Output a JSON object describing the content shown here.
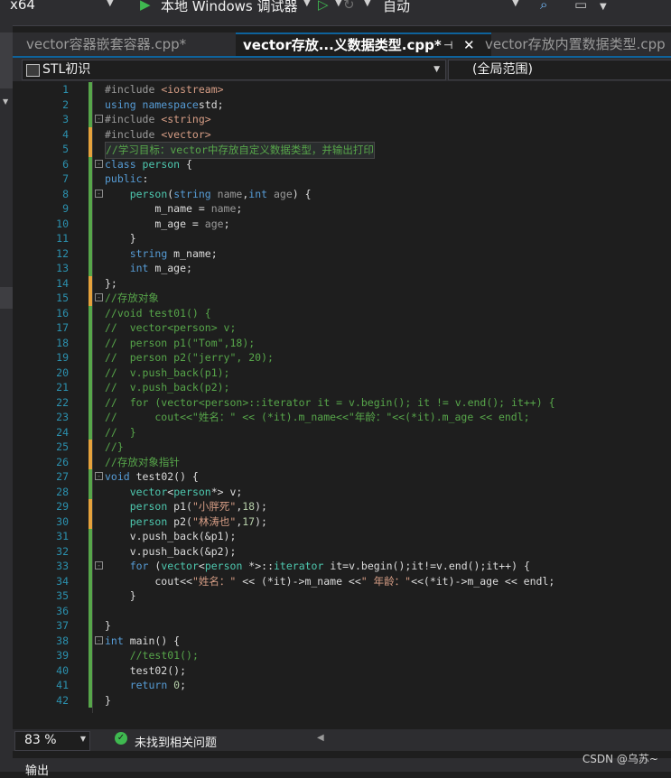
{
  "toolbar": {
    "platform": "x64",
    "run_label": "本地 Windows 调试器",
    "config": "自动"
  },
  "tabs": [
    {
      "label": "vector容器嵌套容器.cpp*",
      "active": false
    },
    {
      "label": "vector存放...义数据类型.cpp*",
      "active": true
    },
    {
      "label": "vector存放内置数据类型.cpp",
      "active": false
    }
  ],
  "navbar": {
    "project": "STL初识",
    "scope": "(全局范围)"
  },
  "code_lines": [
    {
      "n": "1",
      "chg": "g",
      "fold": "",
      "tokens": [
        [
          "pp",
          "#include "
        ],
        [
          "st",
          "<iostream>"
        ]
      ]
    },
    {
      "n": "2",
      "chg": "g",
      "fold": "",
      "tokens": [
        [
          "kw",
          "using namespace"
        ],
        [
          "",
          "std;"
        ]
      ]
    },
    {
      "n": "3",
      "chg": "g",
      "fold": "-",
      "tokens": [
        [
          "pp",
          "#include "
        ],
        [
          "st",
          "<string>"
        ]
      ]
    },
    {
      "n": "4",
      "chg": "y",
      "fold": "",
      "tokens": [
        [
          "pp",
          "#include "
        ],
        [
          "st",
          "<vector>"
        ]
      ]
    },
    {
      "n": "5",
      "chg": "y",
      "fold": "",
      "hl": true,
      "tokens": [
        [
          "cm",
          "//学习目标：vector中存放自定义数据类型，并输出打印"
        ]
      ]
    },
    {
      "n": "6",
      "chg": "g",
      "fold": "-",
      "tokens": [
        [
          "kw",
          "class "
        ],
        [
          "ty",
          "person "
        ],
        [
          "",
          "{"
        ]
      ]
    },
    {
      "n": "7",
      "chg": "g",
      "fold": "",
      "tokens": [
        [
          "kw",
          "public"
        ],
        [
          "",
          ":"
        ]
      ]
    },
    {
      "n": "8",
      "chg": "g",
      "fold": "-",
      "tokens": [
        [
          "",
          "    "
        ],
        [
          "ty",
          "person"
        ],
        [
          "",
          "("
        ],
        [
          "kw",
          "string "
        ],
        [
          "pa",
          "name"
        ],
        [
          "",
          ","
        ],
        [
          "kw",
          "int "
        ],
        [
          "pa",
          "age"
        ],
        [
          "",
          ") {"
        ]
      ]
    },
    {
      "n": "9",
      "chg": "g",
      "fold": "",
      "tokens": [
        [
          "",
          "        m_name = "
        ],
        [
          "pa",
          "name"
        ],
        [
          "",
          ";"
        ]
      ]
    },
    {
      "n": "10",
      "chg": "g",
      "fold": "",
      "tokens": [
        [
          "",
          "        m_age = "
        ],
        [
          "pa",
          "age"
        ],
        [
          "",
          ";"
        ]
      ]
    },
    {
      "n": "11",
      "chg": "g",
      "fold": "",
      "tokens": [
        [
          "",
          "    }"
        ]
      ]
    },
    {
      "n": "12",
      "chg": "g",
      "fold": "",
      "tokens": [
        [
          "",
          "    "
        ],
        [
          "kw",
          "string "
        ],
        [
          "",
          "m_name;"
        ]
      ]
    },
    {
      "n": "13",
      "chg": "g",
      "fold": "",
      "tokens": [
        [
          "",
          "    "
        ],
        [
          "kw",
          "int "
        ],
        [
          "",
          "m_age;"
        ]
      ]
    },
    {
      "n": "14",
      "chg": "y",
      "fold": "",
      "tokens": [
        [
          "",
          "};"
        ]
      ]
    },
    {
      "n": "15",
      "chg": "y",
      "fold": "-",
      "tokens": [
        [
          "cm",
          "//存放对象"
        ]
      ]
    },
    {
      "n": "16",
      "chg": "g",
      "fold": "",
      "tokens": [
        [
          "cm",
          "//void test01() {"
        ]
      ]
    },
    {
      "n": "17",
      "chg": "g",
      "fold": "",
      "tokens": [
        [
          "cm",
          "//  vector<person> v;"
        ]
      ]
    },
    {
      "n": "18",
      "chg": "g",
      "fold": "",
      "tokens": [
        [
          "cm",
          "//  person p1(\"Tom\",18);"
        ]
      ]
    },
    {
      "n": "19",
      "chg": "g",
      "fold": "",
      "tokens": [
        [
          "cm",
          "//  person p2(\"jerry\", 20);"
        ]
      ]
    },
    {
      "n": "20",
      "chg": "g",
      "fold": "",
      "tokens": [
        [
          "cm",
          "//  v.push_back(p1);"
        ]
      ]
    },
    {
      "n": "21",
      "chg": "g",
      "fold": "",
      "tokens": [
        [
          "cm",
          "//  v.push_back(p2);"
        ]
      ]
    },
    {
      "n": "22",
      "chg": "g",
      "fold": "",
      "tokens": [
        [
          "cm",
          "//  for (vector<person>::iterator it = v.begin(); it != v.end(); it++) {"
        ]
      ]
    },
    {
      "n": "23",
      "chg": "g",
      "fold": "",
      "tokens": [
        [
          "cm",
          "//      cout<<\"姓名：\" << (*it).m_name<<\"年龄：\"<<(*it).m_age << endl;"
        ]
      ]
    },
    {
      "n": "24",
      "chg": "g",
      "fold": "",
      "tokens": [
        [
          "cm",
          "//  }"
        ]
      ]
    },
    {
      "n": "25",
      "chg": "y",
      "fold": "",
      "tokens": [
        [
          "cm",
          "//}"
        ]
      ]
    },
    {
      "n": "26",
      "chg": "y",
      "fold": "",
      "tokens": [
        [
          "cm",
          "//存放对象指针"
        ]
      ]
    },
    {
      "n": "27",
      "chg": "g",
      "fold": "-",
      "tokens": [
        [
          "kw",
          "void "
        ],
        [
          "",
          "test02() {"
        ]
      ]
    },
    {
      "n": "28",
      "chg": "g",
      "fold": "",
      "tokens": [
        [
          "",
          "    "
        ],
        [
          "ty",
          "vector"
        ],
        [
          "",
          "<"
        ],
        [
          "ty",
          "person"
        ],
        [
          "",
          "*> v;"
        ]
      ]
    },
    {
      "n": "29",
      "chg": "y",
      "fold": "",
      "tokens": [
        [
          "",
          "    "
        ],
        [
          "ty",
          "person "
        ],
        [
          "",
          "p1("
        ],
        [
          "st",
          "\"小胖死\""
        ],
        [
          "",
          ","
        ],
        [
          "nm",
          "18"
        ],
        [
          "",
          ");"
        ]
      ]
    },
    {
      "n": "30",
      "chg": "y",
      "fold": "",
      "tokens": [
        [
          "",
          "    "
        ],
        [
          "ty",
          "person "
        ],
        [
          "",
          "p2("
        ],
        [
          "st",
          "\"林涛也\""
        ],
        [
          "",
          ","
        ],
        [
          "nm",
          "17"
        ],
        [
          "",
          ");"
        ]
      ]
    },
    {
      "n": "31",
      "chg": "g",
      "fold": "",
      "tokens": [
        [
          "",
          "    v.push_back(&p1);"
        ]
      ]
    },
    {
      "n": "32",
      "chg": "g",
      "fold": "",
      "tokens": [
        [
          "",
          "    v.push_back(&p2);"
        ]
      ]
    },
    {
      "n": "33",
      "chg": "g",
      "fold": "-",
      "tokens": [
        [
          "",
          "    "
        ],
        [
          "kw",
          "for "
        ],
        [
          "",
          "("
        ],
        [
          "ty",
          "vector"
        ],
        [
          "",
          "<"
        ],
        [
          "ty",
          "person "
        ],
        [
          "",
          "*>::"
        ],
        [
          "ty",
          "iterator "
        ],
        [
          "",
          "it=v.begin();it!=v.end();it++) {"
        ]
      ]
    },
    {
      "n": "34",
      "chg": "g",
      "fold": "",
      "tokens": [
        [
          "",
          "        cout<<"
        ],
        [
          "st",
          "\"姓名：\""
        ],
        [
          "",
          ""
        ],
        [
          "",
          ""
        ],
        [
          "",
          ""
        ],
        [
          "",
          ""
        ],
        [
          "",
          ""
        ],
        [
          "",
          ""
        ],
        [
          "",
          ""
        ],
        [
          "",
          ""
        ],
        [
          "",
          ""
        ],
        [
          "",
          ""
        ],
        [
          "",
          ""
        ],
        [
          "",
          ""
        ],
        [
          "",
          ""
        ],
        [
          "",
          ""
        ],
        [
          "",
          ""
        ],
        [
          "",
          ""
        ],
        [
          "",
          ""
        ],
        [
          "",
          ""
        ],
        [
          "",
          ""
        ],
        [
          "",
          ""
        ],
        [
          "",
          ""
        ],
        [
          "",
          ""
        ],
        [
          "",
          ""
        ],
        [
          "",
          ""
        ],
        [
          "",
          ""
        ],
        [
          "",
          ""
        ],
        [
          "",
          ""
        ],
        [
          "",
          ""
        ],
        [
          "",
          ""
        ],
        [
          "",
          ""
        ],
        [
          "",
          ""
        ],
        [
          "",
          ""
        ],
        [
          "",
          ""
        ],
        [
          "",
          ""
        ],
        [
          "",
          ""
        ],
        [
          "",
          ""
        ],
        [
          "",
          ""
        ],
        [
          "",
          ""
        ],
        [
          "",
          ""
        ],
        [
          "",
          ""
        ],
        [
          "",
          ""
        ],
        [
          "",
          ""
        ],
        [
          "",
          ""
        ],
        [
          "",
          ""
        ],
        [
          "",
          ""
        ],
        [
          "",
          ""
        ],
        [
          "",
          ""
        ],
        [
          "",
          ""
        ],
        [
          "",
          ""
        ],
        [
          "",
          ""
        ],
        [
          "",
          ""
        ],
        [
          "",
          ""
        ],
        [
          "",
          ""
        ],
        [
          "",
          ""
        ],
        [
          "",
          ""
        ],
        [
          "",
          ""
        ],
        [
          "",
          ""
        ],
        [
          "",
          ""
        ],
        [
          "",
          " << (*it)->m_name <<"
        ],
        [
          "st",
          "\" 年龄：\""
        ],
        [
          "",
          "<<(*it)->m_age << endl;"
        ]
      ]
    },
    {
      "n": "35",
      "chg": "g",
      "fold": "",
      "tokens": [
        [
          "",
          "    }"
        ]
      ]
    },
    {
      "n": "36",
      "chg": "g",
      "fold": "",
      "tokens": [
        [
          "",
          ""
        ]
      ]
    },
    {
      "n": "37",
      "chg": "g",
      "fold": "",
      "tokens": [
        [
          "",
          "}"
        ]
      ]
    },
    {
      "n": "38",
      "chg": "g",
      "fold": "-",
      "tokens": [
        [
          "kw",
          "int "
        ],
        [
          "",
          "main() {"
        ]
      ]
    },
    {
      "n": "39",
      "chg": "g",
      "fold": "",
      "tokens": [
        [
          "",
          "    "
        ],
        [
          "cm",
          "//test01();"
        ]
      ]
    },
    {
      "n": "40",
      "chg": "g",
      "fold": "",
      "tokens": [
        [
          "",
          "    test02();"
        ]
      ]
    },
    {
      "n": "41",
      "chg": "g",
      "fold": "",
      "tokens": [
        [
          "",
          "    "
        ],
        [
          "kw",
          "return "
        ],
        [
          "nm",
          "0"
        ],
        [
          "",
          ";"
        ]
      ]
    },
    {
      "n": "42",
      "chg": "g",
      "fold": "",
      "tokens": [
        [
          "",
          "}"
        ]
      ]
    }
  ],
  "statusbar": {
    "zoom": "83 %",
    "issues": "未找到相关问题"
  },
  "bottom": {
    "output_label": "输出",
    "watermark": "CSDN @乌苏~"
  },
  "colors": {
    "change_saved": "#57a64a",
    "change_unsaved": "#e6a23c",
    "check": "#3fb950"
  }
}
